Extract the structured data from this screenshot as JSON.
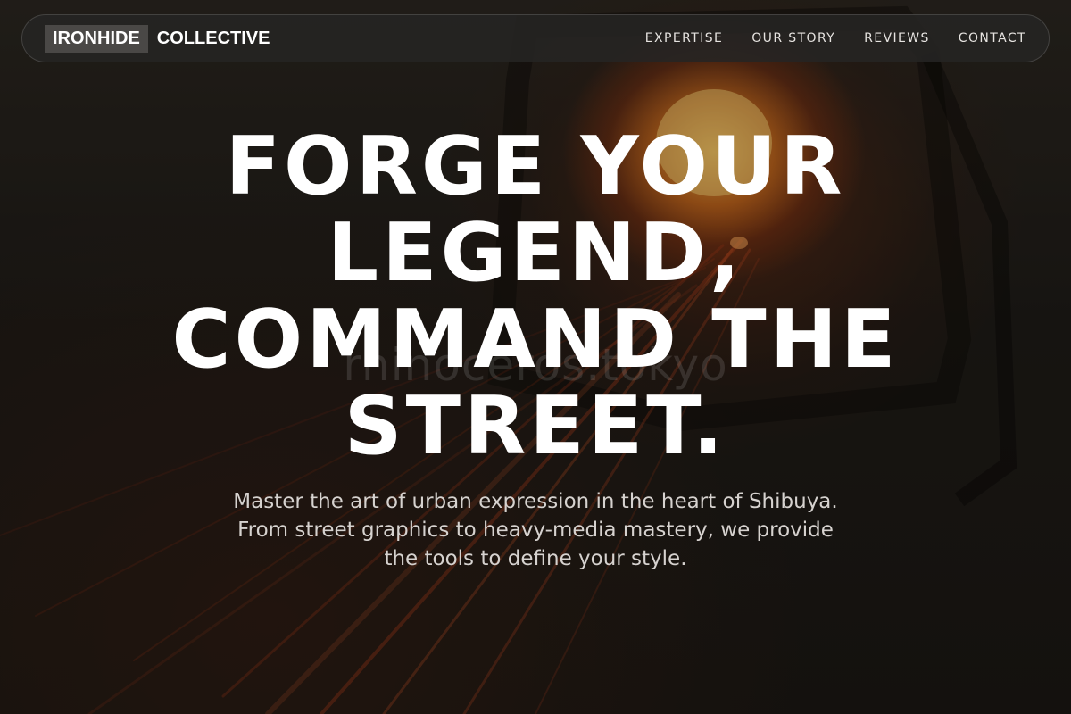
{
  "brand": {
    "logo_part1": "IRONHIDE",
    "logo_part2": "COLLECTIVE"
  },
  "nav": {
    "items": [
      {
        "label": "EXPERTISE"
      },
      {
        "label": "OUR STORY"
      },
      {
        "label": "REVIEWS"
      },
      {
        "label": "CONTACT"
      }
    ]
  },
  "hero": {
    "headline": "FORGE YOUR LEGEND, COMMAND THE STREET.",
    "subtext": "Master the art of urban expression in the heart of Shibuya. From street graphics to heavy-media mastery, we provide the tools to define your style.",
    "watermark": "rhinoceros.tokyo"
  },
  "colors": {
    "accent_glow": "#f0a23c",
    "background": "#1d1a17",
    "text_primary": "#ffffff",
    "text_secondary": "#d6d2cf",
    "nav_background": "#262423"
  }
}
